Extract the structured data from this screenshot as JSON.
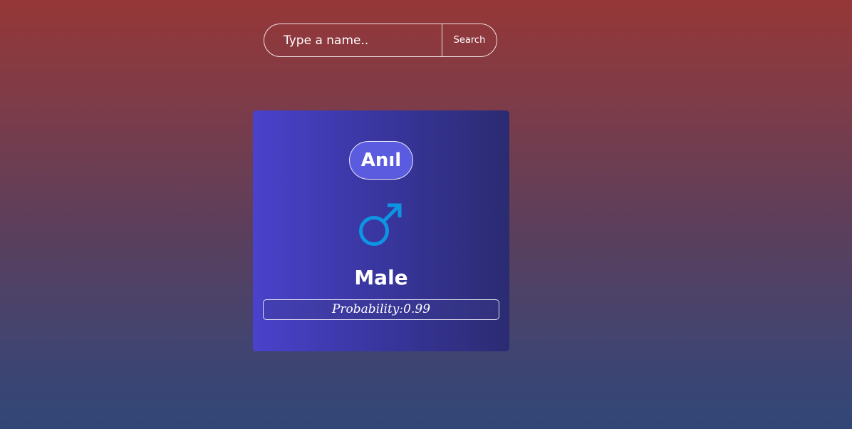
{
  "search": {
    "placeholder": "Type a name..",
    "value": "",
    "button_label": "Search"
  },
  "result": {
    "name": "Anıl",
    "gender_icon": "male-symbol-icon",
    "gender": "Male",
    "probability_label": "Probability:",
    "probability": "0.99"
  },
  "colors": {
    "icon": "#0d95e4",
    "card_start": "#4a42cc",
    "card_end": "#2b2b72",
    "pill": "#5b5be0"
  }
}
